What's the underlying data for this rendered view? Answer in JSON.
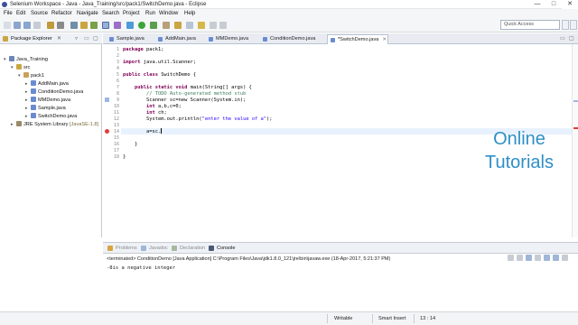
{
  "window": {
    "title": "Selenium Workspace - Java - Java_Training/src/pack1/SwitchDemo.java - Eclipse",
    "controls": {
      "minimize": "—",
      "maximize": "□",
      "close": "✕"
    }
  },
  "menubar": [
    "File",
    "Edit",
    "Source",
    "Refactor",
    "Navigate",
    "Search",
    "Project",
    "Run",
    "Window",
    "Help"
  ],
  "toolbar": {
    "quick_access_placeholder": "Quick Access"
  },
  "package_explorer": {
    "title": "Package Explorer",
    "controls": {
      "close": "✕",
      "menu": "▿",
      "minimize": "▭",
      "maximize": "▢"
    },
    "tree": [
      {
        "label": "Java_Training",
        "twisty": "▾",
        "icon": "project-icon"
      },
      {
        "label": "src",
        "twisty": "▾",
        "icon": "source-folder-icon"
      },
      {
        "label": "pack1",
        "twisty": "▾",
        "icon": "package-icon"
      },
      {
        "label": "AddMain.java",
        "twisty": "▸",
        "icon": "java-file-icon"
      },
      {
        "label": "ConditionDemo.java",
        "twisty": "▸",
        "icon": "java-file-icon"
      },
      {
        "label": "MMDemo.java",
        "twisty": "▸",
        "icon": "java-file-icon"
      },
      {
        "label": "Sample.java",
        "twisty": "▸",
        "icon": "java-file-icon"
      },
      {
        "label": "SwitchDemo.java",
        "twisty": "▸",
        "icon": "java-file-icon"
      },
      {
        "label": "JRE System Library",
        "suffix": "[JavaSE-1.8]",
        "twisty": "▸",
        "icon": "library-icon"
      }
    ]
  },
  "editor": {
    "tabs": [
      {
        "label": "Sample.java",
        "active": false
      },
      {
        "label": "AddMain.java",
        "active": false
      },
      {
        "label": "MMDemo.java",
        "active": false
      },
      {
        "label": "ConditionDemo.java",
        "active": false
      },
      {
        "label": "*SwitchDemo.java",
        "active": true,
        "close": "✕"
      }
    ],
    "controls": {
      "minimize": "▭",
      "maximize": "▢"
    },
    "line_numbers": [
      "1",
      "2",
      "3",
      "4",
      "5",
      "6",
      "7",
      "8",
      "9",
      "10",
      "11",
      "12",
      "13",
      "14",
      "15",
      "16",
      "17",
      "18"
    ],
    "code": {
      "l1_kw": "package",
      "l1_rest": " pack1;",
      "l3_kw": "import",
      "l3_rest": " java.util.Scanner;",
      "l5_kw": "public class",
      "l5_rest": " SwitchDemo {",
      "l7_kw": "    public static void",
      "l7_rest": " main(String[] args) {",
      "l8_cm": "        // TODO Auto-generated method stub",
      "l9": "        Scanner sc=new Scanner(System.in);",
      "l10_kw": "        int",
      "l10_rest": " a,b,c=0;",
      "l11_kw": "        int",
      "l11_rest": " ch;",
      "l12_pre": "        System.out.println(",
      "l12_str": "\"enter the value of a\"",
      "l12_post": ");",
      "l13": "        a=sc.",
      "l15": "    }",
      "l17": "}"
    }
  },
  "watermark": {
    "line1": "Online",
    "line2": "Tutorials"
  },
  "console": {
    "tabs": [
      "Problems",
      "Javadoc",
      "Declaration",
      "Console"
    ],
    "active_tab": "Console",
    "terminated_line": "<terminated> ConditionDemo [Java Application] C:\\Program Files\\Java\\jdk1.8.0_121\\jre\\bin\\javaw.exe (18-Apr-2017, 5:21:37 PM)",
    "output": "-8is a negative integer"
  },
  "statusbar": {
    "mode": "Writable",
    "insert": "Smart Insert",
    "position": "13 : 14"
  },
  "colors": {
    "keyword": "#7f0055",
    "comment": "#3f7f5f",
    "string": "#2a00ff",
    "watermark": "#2f8fc6",
    "current_line": "#e8f2fe"
  }
}
